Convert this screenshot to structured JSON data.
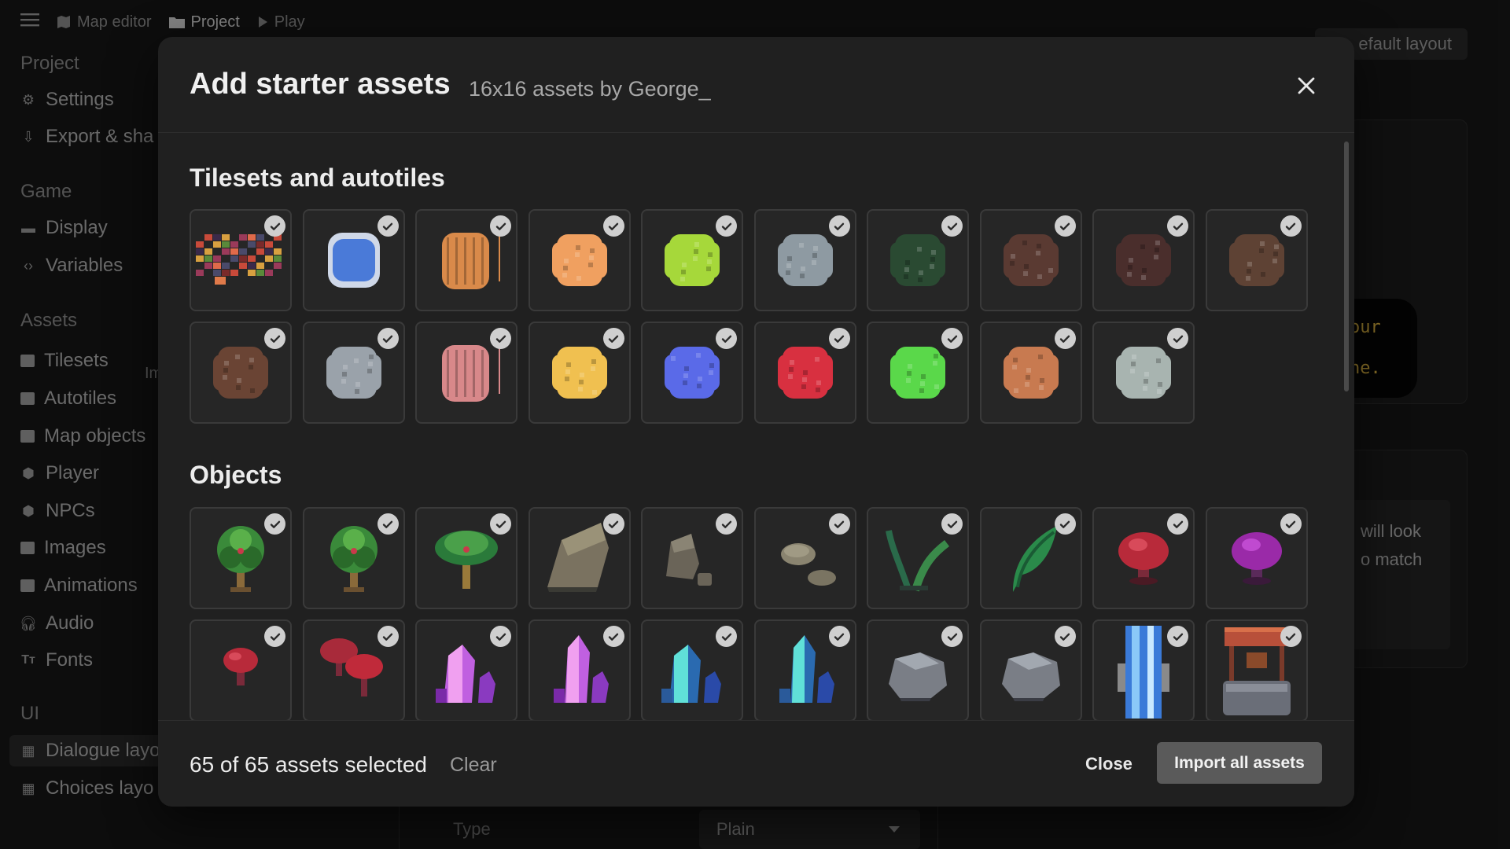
{
  "topbar": {
    "map_editor": "Map editor",
    "project": "Project",
    "play": "Play"
  },
  "sidebar": {
    "project_title": "Project",
    "settings": "Settings",
    "export_share": "Export & sha",
    "game_title": "Game",
    "display": "Display",
    "variables": "Variables",
    "assets_title": "Assets",
    "assets_import": "Im",
    "tilesets": "Tilesets",
    "autotiles": "Autotiles",
    "map_objects": "Map objects",
    "player": "Player",
    "npcs": "NPCs",
    "images": "Images",
    "animations": "Animations",
    "audio": "Audio",
    "fonts": "Fonts",
    "ui_title": "UI",
    "dialogue_layout": "Dialogue layo",
    "choices_layout": "Choices layo"
  },
  "background": {
    "layout_button": "efault layout",
    "preview_line1": "our",
    "preview_line2": "ne.",
    "text_line1": " will look",
    "text_line2": "o match",
    "type_label": "Type",
    "type_value": "Plain"
  },
  "modal": {
    "title": "Add starter assets",
    "subtitle": "16x16 assets by George_",
    "tilesets_heading": "Tilesets and autotiles",
    "objects_heading": "Objects",
    "selected_count": "65 of 65 assets selected",
    "clear": "Clear",
    "close": "Close",
    "import": "Import all assets"
  },
  "tilesets": [
    {
      "name": "tileset-sheet",
      "color": "#7a2a2a"
    },
    {
      "name": "water",
      "color": "#4a7ad8"
    },
    {
      "name": "wood-fence",
      "color": "#d98a4a"
    },
    {
      "name": "sand-orange",
      "color": "#f0a060"
    },
    {
      "name": "grass-light",
      "color": "#a6d83a"
    },
    {
      "name": "stone-grey",
      "color": "#8e9aa2"
    },
    {
      "name": "grass-dark",
      "color": "#2a4a32"
    },
    {
      "name": "dirt-dark",
      "color": "#5a3a32"
    },
    {
      "name": "dirt-dark-small",
      "color": "#4a2e2c"
    },
    {
      "name": "dirt-brown",
      "color": "#5e4234"
    },
    {
      "name": "soil-brown",
      "color": "#6a4434"
    },
    {
      "name": "gravel-grey",
      "color": "#9aa2aa"
    },
    {
      "name": "pink-fence",
      "color": "#d8888a"
    },
    {
      "name": "sand-yellow",
      "color": "#f0c050"
    },
    {
      "name": "water-blue",
      "color": "#5a6ae8"
    },
    {
      "name": "lava-red",
      "color": "#d83040"
    },
    {
      "name": "grass-green",
      "color": "#5ad84a"
    },
    {
      "name": "cobble-orange",
      "color": "#c87a50"
    },
    {
      "name": "cobble-grey",
      "color": "#a8b4b0"
    }
  ],
  "objects": [
    {
      "name": "palm-tree-1",
      "kind": "tree"
    },
    {
      "name": "palm-tree-2",
      "kind": "tree"
    },
    {
      "name": "palm-tree-3",
      "kind": "palm"
    },
    {
      "name": "rock-large",
      "kind": "rock-big"
    },
    {
      "name": "rock-medium",
      "kind": "rock-mid"
    },
    {
      "name": "rock-small",
      "kind": "rock-small"
    },
    {
      "name": "plant-sprout",
      "kind": "sprout"
    },
    {
      "name": "plant-leaf",
      "kind": "leaf"
    },
    {
      "name": "mushroom-red",
      "kind": "mush-red"
    },
    {
      "name": "mushroom-purple",
      "kind": "mush-purple"
    },
    {
      "name": "mushroom-small-red",
      "kind": "mush-small"
    },
    {
      "name": "mushroom-pair-red",
      "kind": "mush-pair"
    },
    {
      "name": "crystal-pink-1",
      "kind": "crystal-pink"
    },
    {
      "name": "crystal-pink-2",
      "kind": "crystal-pink-tall"
    },
    {
      "name": "crystal-teal-1",
      "kind": "crystal-teal"
    },
    {
      "name": "crystal-teal-2",
      "kind": "crystal-teal-tall"
    },
    {
      "name": "boulder-grey-1",
      "kind": "boulder"
    },
    {
      "name": "boulder-grey-2",
      "kind": "boulder2"
    },
    {
      "name": "waterfall",
      "kind": "waterfall"
    },
    {
      "name": "well",
      "kind": "well"
    }
  ]
}
